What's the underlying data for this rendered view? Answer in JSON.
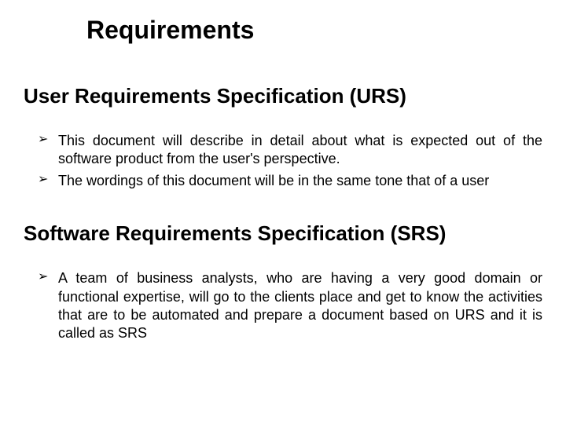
{
  "title": "Requirements",
  "sections": [
    {
      "heading": "User  Requirements  Specification  (URS)",
      "bullets": [
        "This document will  describe  in  detail  about  what  is  expected  out  of the  software  product from  the  user's  perspective.",
        "The wordings of this document will be in the same tone that of a user"
      ]
    },
    {
      "heading": "Software  Requirements  Specification (SRS)",
      "bullets": [
        "A  team of  business  analysts,  who  are  having  a  very  good  domain or  functional expertise,  will  go  to  the  clients  place  and  get  to know  the  activities  that  are to  be  automated and prepare a document based on URS and it is called as SRS"
      ]
    }
  ]
}
